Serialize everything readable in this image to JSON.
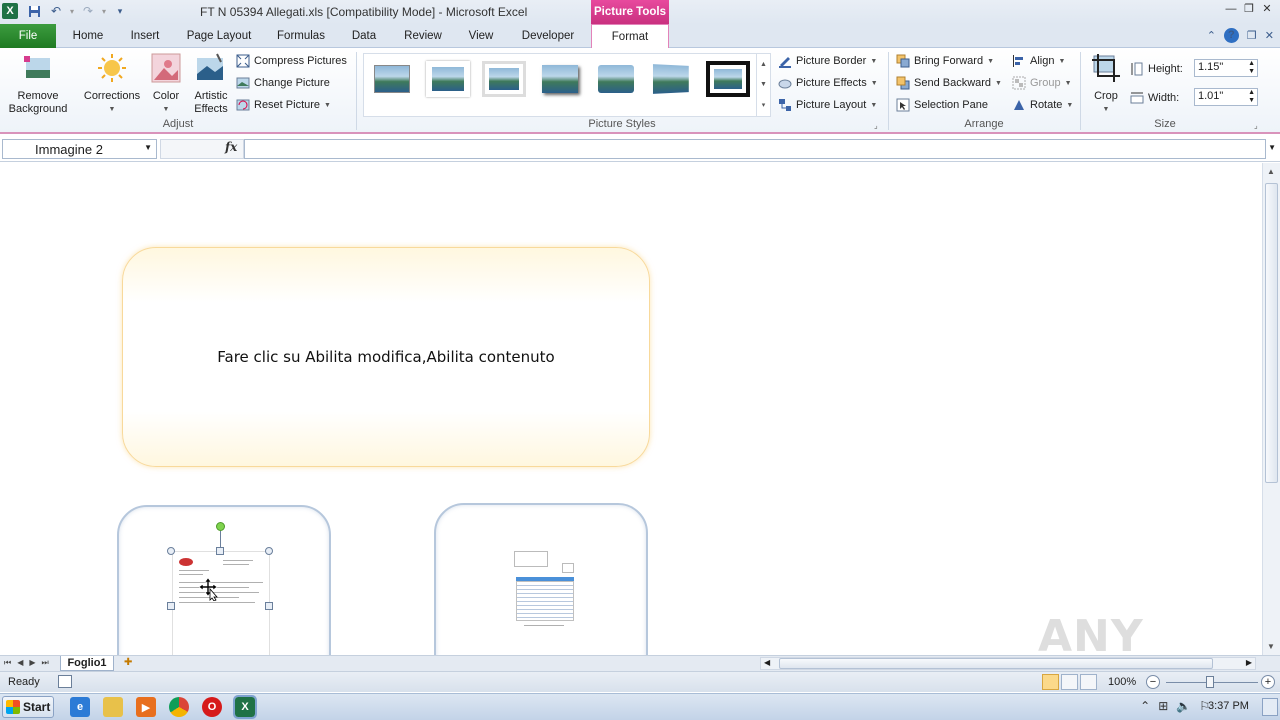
{
  "titlebar": {
    "title": "FT N 05394 Allegati.xls  [Compatibility Mode]  -  Microsoft Excel",
    "context_tab": "Picture Tools"
  },
  "tabs": [
    {
      "label": "File"
    },
    {
      "label": "Home"
    },
    {
      "label": "Insert"
    },
    {
      "label": "Page Layout"
    },
    {
      "label": "Formulas"
    },
    {
      "label": "Data"
    },
    {
      "label": "Review"
    },
    {
      "label": "View"
    },
    {
      "label": "Developer"
    },
    {
      "label": "Format"
    }
  ],
  "ribbon": {
    "adjust": {
      "remove_background": "Remove Background",
      "corrections": "Corrections",
      "color": "Color",
      "artistic_effects": "Artistic Effects",
      "compress": "Compress Pictures",
      "change": "Change Picture",
      "reset": "Reset Picture",
      "label": "Adjust"
    },
    "styles": {
      "border": "Picture Border",
      "effects": "Picture Effects",
      "layout": "Picture Layout",
      "label": "Picture Styles"
    },
    "arrange": {
      "bring_forward": "Bring Forward",
      "send_backward": "Send Backward",
      "selection_pane": "Selection Pane",
      "align": "Align",
      "group": "Group",
      "rotate": "Rotate",
      "label": "Arrange"
    },
    "size": {
      "crop": "Crop",
      "height_label": "Height:",
      "height_value": "1.15\"",
      "width_label": "Width:",
      "width_value": "1.01\"",
      "label": "Size"
    }
  },
  "formula": {
    "name_box": "Immagine 2",
    "fx": "fx",
    "value": ""
  },
  "sheet": {
    "callout_text": "Fare clic su Abilita modifica,Abilita contenuto",
    "watermark": "ANY RUN"
  },
  "sheet_tabs": {
    "active": "Foglio1"
  },
  "status": {
    "ready": "Ready",
    "zoom": "100%",
    "zoom_minus": "−",
    "zoom_plus": "+"
  },
  "taskbar": {
    "start": "Start",
    "time": "3:37 PM"
  },
  "colors": {
    "file_tab": "#2a8a2d",
    "context_tab": "#d63c8e",
    "callout_border": "#f8d99b",
    "card_border": "#b6c7dc"
  }
}
